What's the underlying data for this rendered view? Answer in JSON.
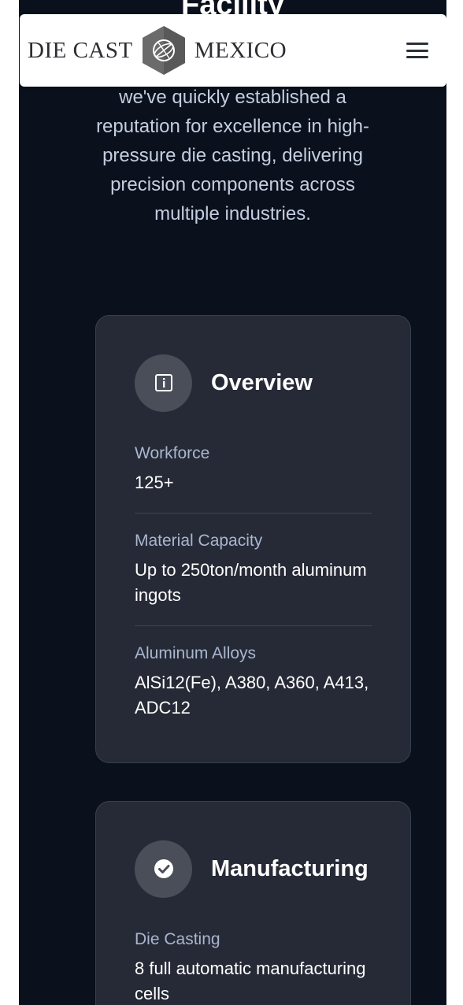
{
  "header": {
    "logo_left": "DIE CAST",
    "logo_right": "MEXICO",
    "menu_icon": "hamburger-menu-icon"
  },
  "hero": {
    "title_partial": "Facility",
    "intro": "we've quickly established a reputation for excellence in high-pressure die casting, delivering precision components across multiple industries."
  },
  "cards": [
    {
      "icon": "info-icon",
      "title": "Overview",
      "items": [
        {
          "label": "Workforce",
          "value": "125+"
        },
        {
          "label": "Material Capacity",
          "value": "Up to 250ton/month aluminum ingots"
        },
        {
          "label": "Aluminum Alloys",
          "value": "AlSi12(Fe), A380, A360, A413, ADC12"
        }
      ]
    },
    {
      "icon": "check-circle-icon",
      "title": "Manufacturing",
      "items": [
        {
          "label": "Die Casting",
          "value": "8 full automatic manufacturing cells"
        }
      ]
    }
  ],
  "colors": {
    "page_bg": "#0b111c",
    "card_bg": "#262a36",
    "label": "#a9b6cf",
    "intro_text": "#c3cee0"
  }
}
